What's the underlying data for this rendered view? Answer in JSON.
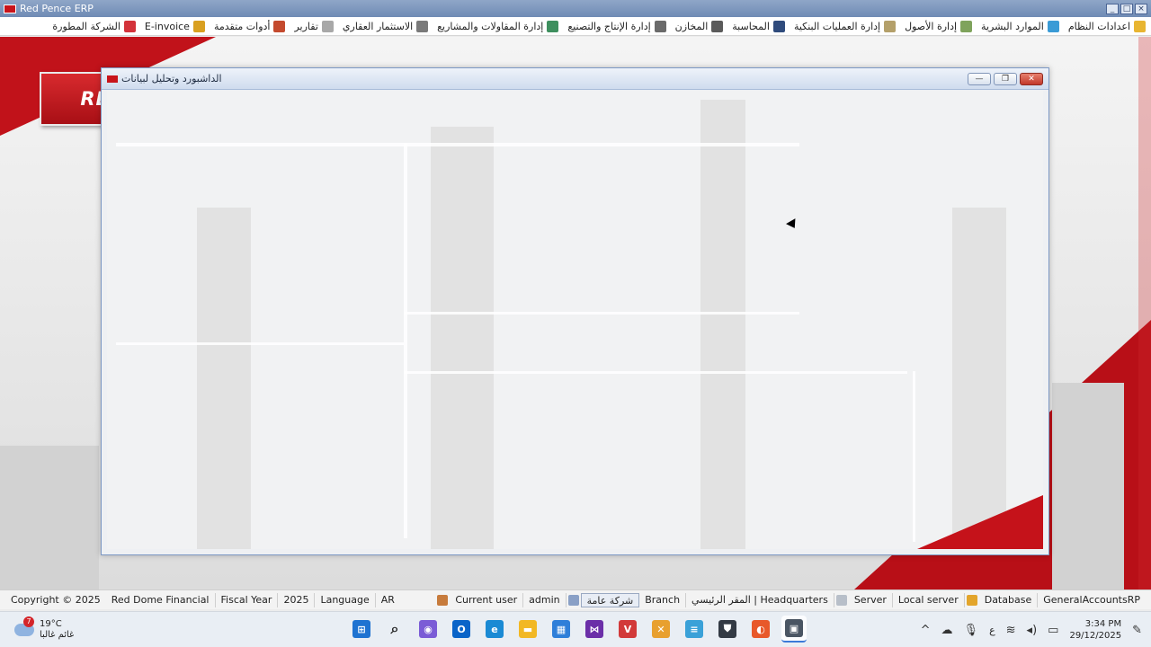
{
  "window": {
    "title": "Red Pence ERP"
  },
  "menu": [
    {
      "label": "اعدادات النظام",
      "color": "#e8b531"
    },
    {
      "label": "الموارد البشرية",
      "color": "#3a9bd6"
    },
    {
      "label": "إدارة الأصول",
      "color": "#7fa35c"
    },
    {
      "label": "إدارة العمليات البنكية",
      "color": "#b4a06a"
    },
    {
      "label": "المحاسبة",
      "color": "#2f4b7c"
    },
    {
      "label": "المخازن",
      "color": "#5b5b5b"
    },
    {
      "label": "إدارة الإنتاج والتصنيع",
      "color": "#6a6a6a"
    },
    {
      "label": "إدارة المقاولات والمشاريع",
      "color": "#3e8f5e"
    },
    {
      "label": "الاستثمار العقاري",
      "color": "#7a7a7a"
    },
    {
      "label": "تقارير",
      "color": "#a8a8a8"
    },
    {
      "label": "أدوات متقدمة",
      "color": "#c44a2e"
    },
    {
      "label": "E-invoice",
      "color": "#d9a020"
    },
    {
      "label": "الشركة المطورة",
      "color": "#d3323a"
    }
  ],
  "logo": {
    "text": "RED PENCE"
  },
  "child_window": {
    "title": "الداشبورد وتحليل لبيانات"
  },
  "status": {
    "copyright": "Copyright © 2025",
    "company": "Red Dome Financial",
    "fiscal_year_label": "Fiscal Year",
    "fiscal_year": "2025",
    "language_label": "Language",
    "language": "AR",
    "current_user_label": "Current user",
    "current_user": "admin",
    "company_type": "شركة عامة",
    "branch_label": "Branch",
    "branch": "المقر الرئيسي | Headquarters",
    "server_label": "Server",
    "server": "Local server",
    "database_label": "Database",
    "database": "GeneralAccountsRP"
  },
  "taskbar": {
    "weather_temp": "19°C",
    "weather_badge": "7",
    "weather_desc": "غائم غالبا",
    "apps": [
      {
        "name": "windows-start-icon",
        "color": "#1f73d1",
        "glyph": "⊞"
      },
      {
        "name": "search-icon",
        "color": "#e9eef4",
        "glyph": "⌕"
      },
      {
        "name": "copilot-icon",
        "color": "#7b5cd6",
        "glyph": "◉"
      },
      {
        "name": "outlook-icon",
        "color": "#0a64c8",
        "glyph": "O"
      },
      {
        "name": "edge-icon",
        "color": "#1a8ad4",
        "glyph": "e"
      },
      {
        "name": "file-explorer-icon",
        "color": "#f2b824",
        "glyph": "▬"
      },
      {
        "name": "store-icon",
        "color": "#2f7fd9",
        "glyph": "▦"
      },
      {
        "name": "visual-studio-icon",
        "color": "#6b2fa8",
        "glyph": "⋈"
      },
      {
        "name": "vivaldi-icon",
        "color": "#d23a3a",
        "glyph": "V"
      },
      {
        "name": "photos-icon",
        "color": "#e8a02f",
        "glyph": "✕"
      },
      {
        "name": "notepad-icon",
        "color": "#3aa1d8",
        "glyph": "≡"
      },
      {
        "name": "security-icon",
        "color": "#333a44",
        "glyph": "⛊"
      },
      {
        "name": "firefox-icon",
        "color": "#e8582a",
        "glyph": "◐"
      },
      {
        "name": "erp-app-icon",
        "color": "#4a5563",
        "glyph": "▣"
      }
    ],
    "input_lang": "ع",
    "time": "3:34 PM",
    "date": "29/12/2025"
  }
}
